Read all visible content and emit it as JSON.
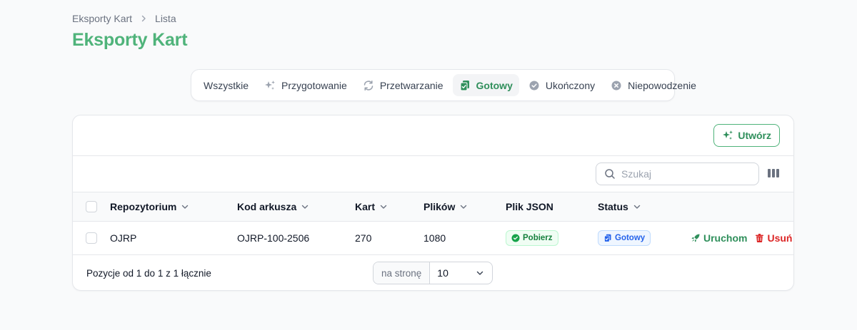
{
  "breadcrumb": {
    "items": [
      "Eksporty Kart",
      "Lista"
    ]
  },
  "page_title": "Eksporty Kart",
  "tabs": [
    {
      "label": "Wszystkie",
      "icon": null,
      "active": false
    },
    {
      "label": "Przygotowanie",
      "icon": "sparkles-icon",
      "active": false
    },
    {
      "label": "Przetwarzanie",
      "icon": "refresh-icon",
      "active": false
    },
    {
      "label": "Gotowy",
      "icon": "document-check-icon",
      "active": true
    },
    {
      "label": "Ukończony",
      "icon": "check-circle-icon",
      "active": false
    },
    {
      "label": "Niepowodzenie",
      "icon": "x-circle-icon",
      "active": false
    }
  ],
  "header": {
    "create_label": "Utwórz"
  },
  "search": {
    "placeholder": "Szukaj",
    "value": ""
  },
  "table": {
    "columns": [
      "Repozytorium",
      "Kod arkusza",
      "Kart",
      "Plików",
      "Plik JSON",
      "Status"
    ],
    "rows": [
      {
        "repository": "OJRP",
        "sheet_code": "OJRP-100-2506",
        "cards": "270",
        "files": "1080",
        "json_action": "Pobierz",
        "status": "Gotowy",
        "run_label": "Uruchom",
        "delete_label": "Usuń"
      }
    ]
  },
  "footer": {
    "summary": "Pozycje od 1 do 1 z 1 łącznie",
    "per_page_label": "na stronę",
    "per_page_value": "10"
  },
  "colors": {
    "brand": "#4fb37a",
    "accent_dark": "#2f8f5b",
    "danger": "#dc2626",
    "info": "#2563eb"
  }
}
